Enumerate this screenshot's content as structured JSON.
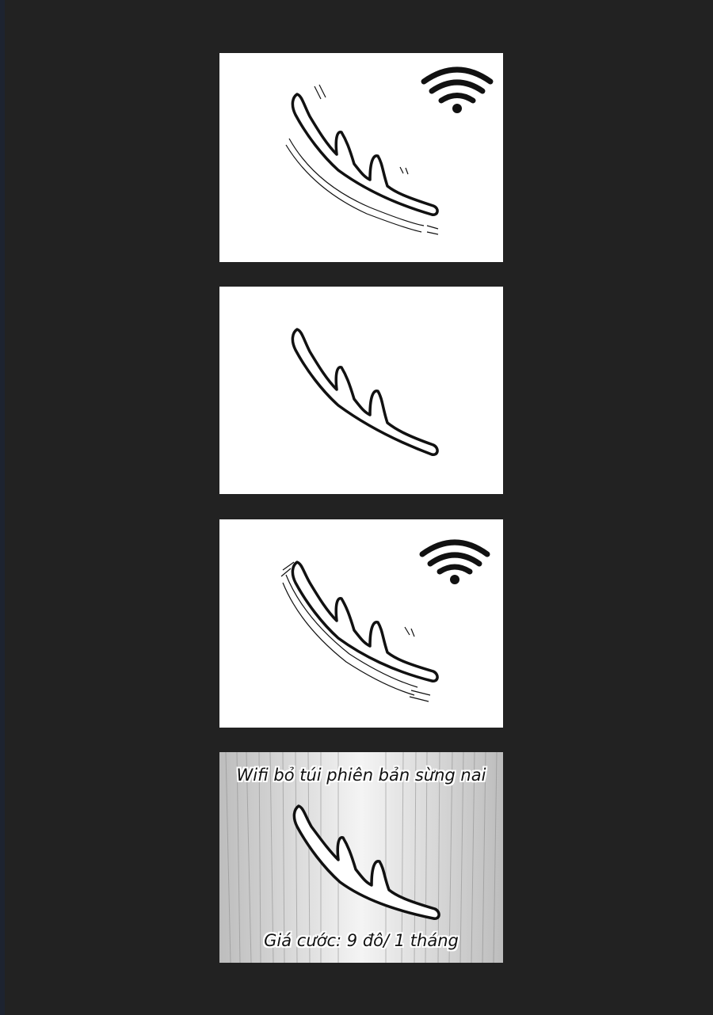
{
  "panels": [
    {
      "name": "panel-antler-wifi-on",
      "wifi_icon": true,
      "motion_lines": true
    },
    {
      "name": "panel-antler-still",
      "wifi_icon": false,
      "motion_lines": false
    },
    {
      "name": "panel-antler-wifi-on-again",
      "wifi_icon": true,
      "motion_lines": true
    },
    {
      "name": "panel-ad",
      "wifi_icon": false,
      "motion_lines": false
    }
  ],
  "ad": {
    "headline": "Wifi bỏ túi phiên bản sừng nai",
    "price": "Giá cước: 9 đô/ 1 tháng"
  },
  "colors": {
    "background": "#222222",
    "panel": "#ffffff",
    "ink": "#111111",
    "speedlines_bg": "#d6d6d6"
  },
  "icons": [
    "wifi-icon",
    "antler-icon"
  ]
}
